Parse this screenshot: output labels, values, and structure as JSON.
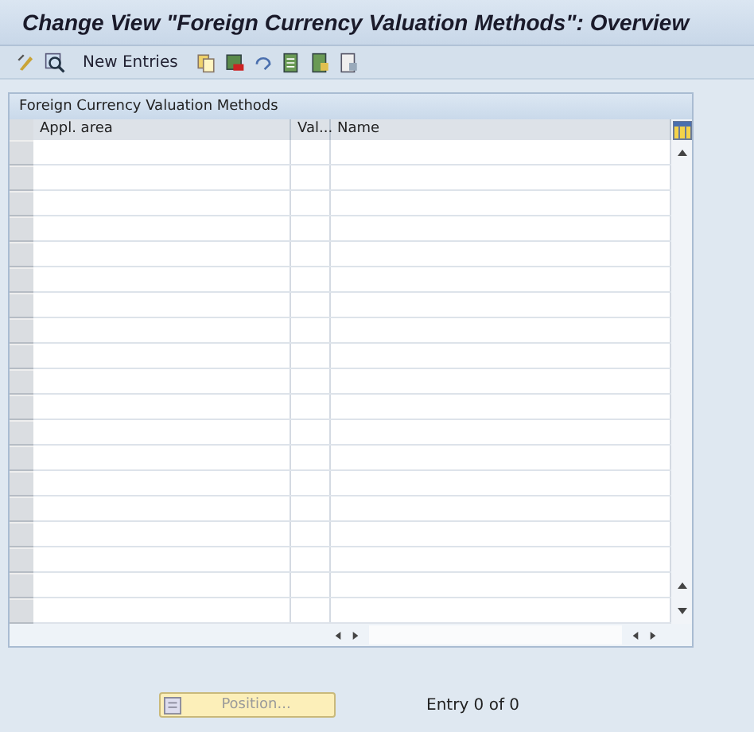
{
  "window": {
    "title": "Change View \"Foreign Currency Valuation Methods\": Overview"
  },
  "toolbar": {
    "new_entries": "New Entries"
  },
  "table": {
    "title": "Foreign Currency Valuation Methods",
    "columns": [
      "Appl. area",
      "Val...",
      "Name"
    ]
  },
  "position_button": {
    "label": "Position...",
    "disabled": true
  },
  "entry_count": "Entry 0 of 0"
}
